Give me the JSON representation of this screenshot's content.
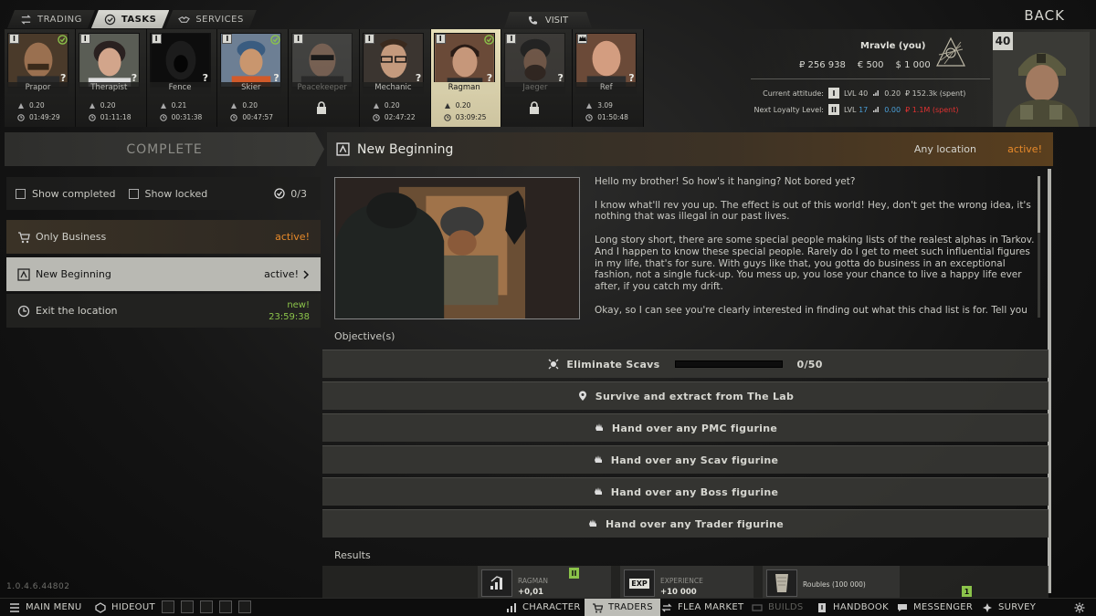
{
  "top_tabs": [
    {
      "label": "TRADING",
      "icon": "trading-icon"
    },
    {
      "label": "TASKS",
      "icon": "tasks-icon"
    },
    {
      "label": "SERVICES",
      "icon": "services-icon"
    }
  ],
  "visit_label": "VISIT",
  "back_label": "BACK",
  "traders": [
    {
      "name": "Prapor",
      "level": "I",
      "standing": "0.20",
      "timer": "01:49:29",
      "alert": "?",
      "check": true
    },
    {
      "name": "Therapist",
      "level": "I",
      "standing": "0.20",
      "timer": "01:11:18",
      "alert": "?",
      "check": false
    },
    {
      "name": "Fence",
      "level": "I",
      "standing": "0.21",
      "timer": "00:31:38",
      "alert": "?",
      "check": false
    },
    {
      "name": "Skier",
      "level": "I",
      "standing": "0.20",
      "timer": "00:47:57",
      "alert": "?",
      "check": true
    },
    {
      "name": "Peacekeeper",
      "level": "I",
      "standing": "",
      "timer": "",
      "alert": "",
      "check": false,
      "locked": true
    },
    {
      "name": "Mechanic",
      "level": "I",
      "standing": "0.20",
      "timer": "02:47:22",
      "alert": "?",
      "check": false
    },
    {
      "name": "Ragman",
      "level": "I",
      "standing": "0.20",
      "timer": "03:09:25",
      "alert": "?",
      "check": true,
      "selected": true
    },
    {
      "name": "Jaeger",
      "level": "I",
      "standing": "",
      "timer": "",
      "alert": "?",
      "check": false,
      "locked": true
    },
    {
      "name": "Ref",
      "level": "crown",
      "standing": "3.09",
      "timer": "01:50:48",
      "alert": "?",
      "check": false
    }
  ],
  "player": {
    "name": "Mravle (you)",
    "roubles": "₽ 256 938",
    "euros": "€ 500",
    "dollars": "$ 1 000",
    "level_badge": "40",
    "current_attitude_label": "Current attitude:",
    "current_level_roman": "I",
    "current_lvl_text": "LVL 40",
    "current_standing": "0.20",
    "current_spent": "₽ 152.3k (spent)",
    "next_loyalty_label": "Next Loyalty Level:",
    "next_level_roman": "II",
    "next_lvl_prefix": "LVL",
    "next_lvl_value": "17",
    "next_standing": "0.00",
    "next_spent": "₽ 1.1M (spent)"
  },
  "left_panel": {
    "complete_label": "COMPLETE",
    "show_completed": "Show completed",
    "show_locked": "Show locked",
    "count": "0/3",
    "quests": [
      {
        "name": "Only Business",
        "status": "active!"
      },
      {
        "name": "New Beginning",
        "status": "active!"
      },
      {
        "name": "Exit the location",
        "status": "new!",
        "timer": "23:59:38"
      }
    ]
  },
  "quest": {
    "title": "New Beginning",
    "location": "Any location",
    "status": "active!",
    "description": [
      "Hello my brother! So how's it hanging? Not bored yet?",
      "I know what'll rev you up. The effect is out of this world! Hey, don't get the wrong idea, it's nothing that was illegal in our past lives.",
      "Long story short, there are some special people making lists of the realest alphas in Tarkov. And I happen to know these special people. Rarely do I get to meet such influential figures in my life, that's for sure. With guys like that, you gotta do business in an exceptional fashion, not a single fuck-up. You mess up, you lose your chance to live a happy life ever after, if you catch my drift.",
      "Okay, so I can see you're clearly interested in finding out what this chad list is for. Tell you"
    ],
    "objectives_label": "Objective(s)",
    "objectives": [
      {
        "text": "Eliminate Scavs",
        "progress": "0/50",
        "progress_fraction": 0,
        "icon": "skull-target-icon"
      },
      {
        "text": "Survive and extract from The Lab",
        "icon": "location-pin-icon"
      },
      {
        "text": "Hand over any PMC figurine",
        "icon": "hand-icon"
      },
      {
        "text": "Hand over any Scav figurine",
        "icon": "hand-icon"
      },
      {
        "text": "Hand over any Boss figurine",
        "icon": "hand-icon"
      },
      {
        "text": "Hand over any Trader figurine",
        "icon": "hand-icon"
      }
    ],
    "results_label": "Results",
    "rewards": [
      {
        "label": "RAGMAN",
        "value": "+0,01",
        "badge": "II"
      },
      {
        "label": "EXPERIENCE",
        "value": "+10 000",
        "icon_text": "EXP"
      },
      {
        "label": "Roubles (100 000)",
        "value": "",
        "badge": "1"
      }
    ]
  },
  "version": "1.0.4.6.44802",
  "bottom_bar": {
    "main_menu": "MAIN MENU",
    "hideout": "HIDEOUT",
    "character": "CHARACTER",
    "traders": "TRADERS",
    "flea_market": "FLEA MARKET",
    "builds": "BUILDS",
    "handbook": "HANDBOOK",
    "messenger": "MESSENGER",
    "survey": "SURVEY"
  },
  "colors": {
    "accent_orange": "#e88a2a",
    "accent_green": "#8bc34a",
    "accent_blue": "#4a9fd8",
    "accent_red": "#e03131"
  }
}
